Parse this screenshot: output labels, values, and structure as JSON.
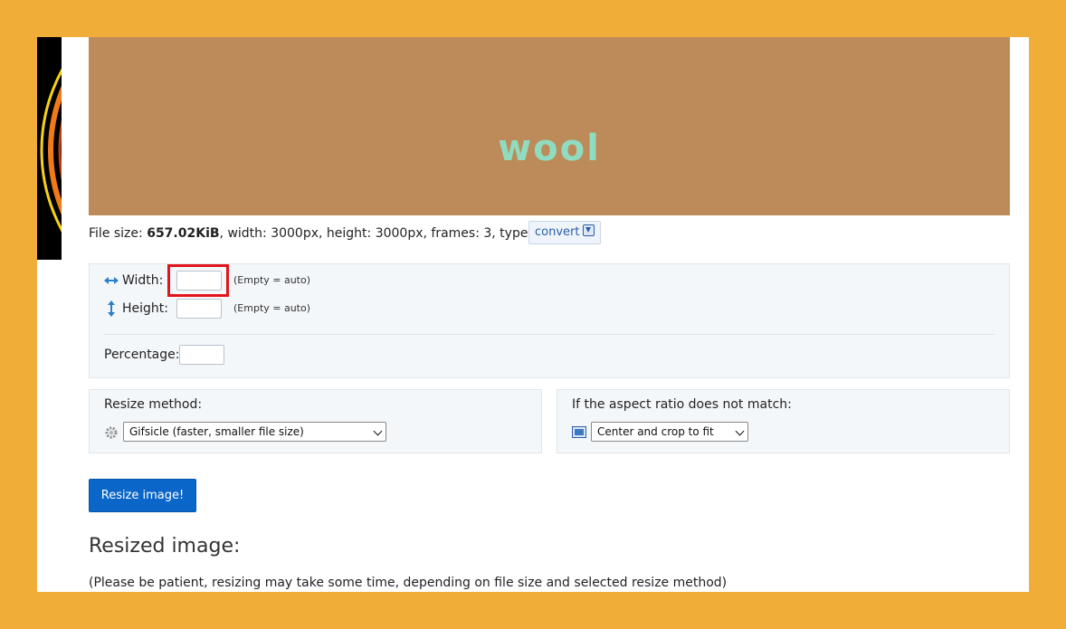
{
  "preview": {
    "image_text": "wool",
    "background": "#bd8b59",
    "text_color": "#8fdcc0"
  },
  "file_info": {
    "size_label": "File size: ",
    "size_value": "657.02KiB",
    "rest": ", width: 3000px, height: 3000px, frames: 3, type: gif",
    "convert_label": "convert",
    "convert_icon": "download-icon"
  },
  "dimensions": {
    "width_label": "Width:",
    "width_value": "",
    "width_hint": "(Empty = auto)",
    "width_icon": "horizontal-arrows-icon",
    "height_label": "Height:",
    "height_value": "",
    "height_hint": "(Empty = auto)",
    "height_icon": "vertical-arrows-icon",
    "percentage_label": "Percentage:",
    "percentage_value": ""
  },
  "resize_method": {
    "title": "Resize method:",
    "icon": "gear-icon",
    "selected": "Gifsicle (faster, smaller file size)"
  },
  "aspect_ratio": {
    "title": "If the aspect ratio does not match:",
    "icon": "picture-frame-icon",
    "selected": "Center and crop to fit"
  },
  "actions": {
    "resize_button": "Resize image!"
  },
  "result": {
    "heading": "Resized image:",
    "note": "(Please be patient, resizing may take some time, depending on file size and selected resize method)"
  },
  "colors": {
    "outer_background": "#f0ae38",
    "accent": "#0a66c9",
    "highlight": "#e3141b"
  }
}
